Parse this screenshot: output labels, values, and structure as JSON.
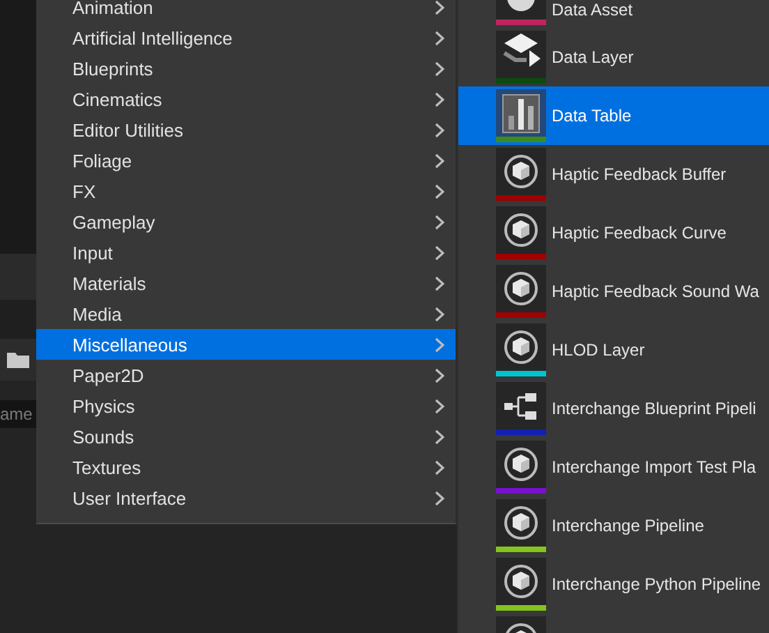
{
  "background": {
    "field": {
      "value": "ame"
    }
  },
  "category_menu": {
    "items": [
      {
        "label": "Animation",
        "selected": false
      },
      {
        "label": "Artificial Intelligence",
        "selected": false
      },
      {
        "label": "Blueprints",
        "selected": false
      },
      {
        "label": "Cinematics",
        "selected": false
      },
      {
        "label": "Editor Utilities",
        "selected": false
      },
      {
        "label": "Foliage",
        "selected": false
      },
      {
        "label": "FX",
        "selected": false
      },
      {
        "label": "Gameplay",
        "selected": false
      },
      {
        "label": "Input",
        "selected": false
      },
      {
        "label": "Materials",
        "selected": false
      },
      {
        "label": "Media",
        "selected": false
      },
      {
        "label": "Miscellaneous",
        "selected": true
      },
      {
        "label": "Paper2D",
        "selected": false
      },
      {
        "label": "Physics",
        "selected": false
      },
      {
        "label": "Sounds",
        "selected": false
      },
      {
        "label": "Textures",
        "selected": false
      },
      {
        "label": "User Interface",
        "selected": false
      }
    ]
  },
  "asset_menu": {
    "items": [
      {
        "label": "Data Asset",
        "kind": "pie",
        "color": "#c0245c",
        "selected": false
      },
      {
        "label": "Data Layer",
        "kind": "layers",
        "color": "#0c4a10",
        "selected": false
      },
      {
        "label": "Data Table",
        "kind": "table",
        "color": "#3c8c1c",
        "selected": true
      },
      {
        "label": "Haptic Feedback Buffer",
        "kind": "cube",
        "color": "#a00000",
        "selected": false
      },
      {
        "label": "Haptic Feedback Curve",
        "kind": "cube",
        "color": "#a00000",
        "selected": false
      },
      {
        "label": "Haptic Feedback Sound Wa",
        "kind": "cube",
        "color": "#a00000",
        "selected": false
      },
      {
        "label": "HLOD Layer",
        "kind": "cube",
        "color": "#00c4d0",
        "selected": false
      },
      {
        "label": "Interchange Blueprint Pipeli",
        "kind": "graph",
        "color": "#1020b4",
        "selected": false
      },
      {
        "label": "Interchange Import Test Pla",
        "kind": "cube",
        "color": "#7810cc",
        "selected": false
      },
      {
        "label": "Interchange Pipeline",
        "kind": "cube",
        "color": "#84c41c",
        "selected": false
      },
      {
        "label": "Interchange Python Pipeline",
        "kind": "cube",
        "color": "#84c41c",
        "selected": false
      },
      {
        "kind": "cube",
        "selected": false
      }
    ]
  }
}
